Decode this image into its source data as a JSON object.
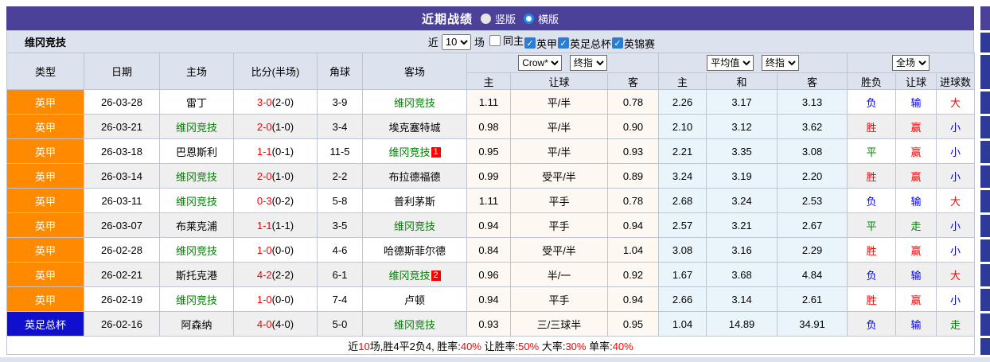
{
  "title_bar": {
    "title": "近期战绩",
    "radio_vertical": "竖版",
    "radio_horizontal": "横版",
    "selected_layout": "横版"
  },
  "filter_bar": {
    "team": "维冈竞技",
    "near_label": "近",
    "near_value": "10",
    "games_label": "场",
    "checkboxes": [
      {
        "label": "同主",
        "checked": false
      },
      {
        "label": "英甲",
        "checked": true
      },
      {
        "label": "英足总杯",
        "checked": true
      },
      {
        "label": "英锦赛",
        "checked": true
      }
    ]
  },
  "icons": {
    "check": "✓"
  },
  "table": {
    "static_headers": [
      "类型",
      "日期",
      "主场",
      "比分(半场)",
      "角球",
      "客场"
    ],
    "group1_selects": [
      "Crow*",
      "终指"
    ],
    "group2_selects": [
      "平均值",
      "终指"
    ],
    "group3_select": "全场",
    "sub_headers_group1": [
      "主",
      "让球",
      "客"
    ],
    "sub_headers_group2": [
      "主",
      "和",
      "客"
    ],
    "sub_headers_group3": [
      "胜负",
      "让球",
      "进球数"
    ],
    "rows": [
      {
        "type": "英甲",
        "type_style": "league",
        "date": "26-03-28",
        "home": {
          "name": "雷丁",
          "self": false
        },
        "score": {
          "full": "3-0",
          "half": "(2-0)"
        },
        "corners": "3-9",
        "away": {
          "name": "维冈竞技",
          "self": true,
          "badge": null
        },
        "asian": [
          "1.11",
          "平/半",
          "0.78"
        ],
        "europe": [
          "2.26",
          "3.17",
          "3.13"
        ],
        "outcome": [
          {
            "t": "负",
            "c": "blue"
          },
          {
            "t": "输",
            "c": "blue"
          },
          {
            "t": "大",
            "c": "red"
          }
        ]
      },
      {
        "type": "英甲",
        "type_style": "league",
        "date": "26-03-21",
        "home": {
          "name": "维冈竞技",
          "self": true
        },
        "score": {
          "full": "2-0",
          "half": "(1-0)"
        },
        "corners": "3-4",
        "away": {
          "name": "埃克塞特城",
          "self": false,
          "badge": null
        },
        "asian": [
          "0.98",
          "平/半",
          "0.90"
        ],
        "europe": [
          "2.10",
          "3.12",
          "3.62"
        ],
        "outcome": [
          {
            "t": "胜",
            "c": "red"
          },
          {
            "t": "赢",
            "c": "red"
          },
          {
            "t": "小",
            "c": "blue"
          }
        ]
      },
      {
        "type": "英甲",
        "type_style": "league",
        "date": "26-03-18",
        "home": {
          "name": "巴恩斯利",
          "self": false
        },
        "score": {
          "full": "1-1",
          "half": "(0-1)"
        },
        "corners": "11-5",
        "away": {
          "name": "维冈竞技",
          "self": true,
          "badge": "1"
        },
        "asian": [
          "0.95",
          "平/半",
          "0.93"
        ],
        "europe": [
          "2.21",
          "3.35",
          "3.08"
        ],
        "outcome": [
          {
            "t": "平",
            "c": "green"
          },
          {
            "t": "赢",
            "c": "red"
          },
          {
            "t": "小",
            "c": "blue"
          }
        ]
      },
      {
        "type": "英甲",
        "type_style": "league",
        "date": "26-03-14",
        "home": {
          "name": "维冈竞技",
          "self": true
        },
        "score": {
          "full": "2-0",
          "half": "(1-0)"
        },
        "corners": "2-2",
        "away": {
          "name": "布拉德福德",
          "self": false,
          "badge": null
        },
        "asian": [
          "0.99",
          "受平/半",
          "0.89"
        ],
        "europe": [
          "3.24",
          "3.19",
          "2.20"
        ],
        "outcome": [
          {
            "t": "胜",
            "c": "red"
          },
          {
            "t": "赢",
            "c": "red"
          },
          {
            "t": "小",
            "c": "blue"
          }
        ]
      },
      {
        "type": "英甲",
        "type_style": "league",
        "date": "26-03-11",
        "home": {
          "name": "维冈竞技",
          "self": true
        },
        "score": {
          "full": "0-3",
          "half": "(0-2)"
        },
        "corners": "5-8",
        "away": {
          "name": "普利茅斯",
          "self": false,
          "badge": null
        },
        "asian": [
          "1.11",
          "平手",
          "0.78"
        ],
        "europe": [
          "2.68",
          "3.24",
          "2.53"
        ],
        "outcome": [
          {
            "t": "负",
            "c": "blue"
          },
          {
            "t": "输",
            "c": "blue"
          },
          {
            "t": "大",
            "c": "red"
          }
        ]
      },
      {
        "type": "英甲",
        "type_style": "league",
        "date": "26-03-07",
        "home": {
          "name": "布莱克浦",
          "self": false
        },
        "score": {
          "full": "1-1",
          "half": "(1-1)"
        },
        "corners": "3-5",
        "away": {
          "name": "维冈竞技",
          "self": true,
          "badge": null
        },
        "asian": [
          "0.94",
          "平手",
          "0.94"
        ],
        "europe": [
          "2.57",
          "3.21",
          "2.67"
        ],
        "outcome": [
          {
            "t": "平",
            "c": "green"
          },
          {
            "t": "走",
            "c": "green"
          },
          {
            "t": "小",
            "c": "blue"
          }
        ]
      },
      {
        "type": "英甲",
        "type_style": "league",
        "date": "26-02-28",
        "home": {
          "name": "维冈竞技",
          "self": true
        },
        "score": {
          "full": "1-0",
          "half": "(0-0)"
        },
        "corners": "4-6",
        "away": {
          "name": "哈德斯菲尔德",
          "self": false,
          "badge": null
        },
        "asian": [
          "0.84",
          "受平/半",
          "1.04"
        ],
        "europe": [
          "3.08",
          "3.16",
          "2.29"
        ],
        "outcome": [
          {
            "t": "胜",
            "c": "red"
          },
          {
            "t": "赢",
            "c": "red"
          },
          {
            "t": "小",
            "c": "blue"
          }
        ]
      },
      {
        "type": "英甲",
        "type_style": "league",
        "date": "26-02-21",
        "home": {
          "name": "斯托克港",
          "self": false
        },
        "score": {
          "full": "4-2",
          "half": "(2-2)"
        },
        "corners": "6-1",
        "away": {
          "name": "维冈竞技",
          "self": true,
          "badge": "2"
        },
        "asian": [
          "0.96",
          "半/一",
          "0.92"
        ],
        "europe": [
          "1.67",
          "3.68",
          "4.84"
        ],
        "outcome": [
          {
            "t": "负",
            "c": "blue"
          },
          {
            "t": "输",
            "c": "blue"
          },
          {
            "t": "大",
            "c": "red"
          }
        ]
      },
      {
        "type": "英甲",
        "type_style": "league",
        "date": "26-02-19",
        "home": {
          "name": "维冈竞技",
          "self": true
        },
        "score": {
          "full": "1-0",
          "half": "(0-0)"
        },
        "corners": "7-4",
        "away": {
          "name": "卢顿",
          "self": false,
          "badge": null
        },
        "asian": [
          "0.94",
          "平手",
          "0.94"
        ],
        "europe": [
          "2.66",
          "3.14",
          "2.61"
        ],
        "outcome": [
          {
            "t": "胜",
            "c": "red"
          },
          {
            "t": "赢",
            "c": "red"
          },
          {
            "t": "小",
            "c": "blue"
          }
        ]
      },
      {
        "type": "英足总杯",
        "type_style": "cup",
        "date": "26-02-16",
        "home": {
          "name": "阿森纳",
          "self": false
        },
        "score": {
          "full": "4-0",
          "half": "(4-0)"
        },
        "corners": "5-0",
        "away": {
          "name": "维冈竞技",
          "self": true,
          "badge": null
        },
        "asian": [
          "0.93",
          "三/三球半",
          "0.95"
        ],
        "europe": [
          "1.04",
          "14.89",
          "34.91"
        ],
        "outcome": [
          {
            "t": "负",
            "c": "blue"
          },
          {
            "t": "输",
            "c": "blue"
          },
          {
            "t": "走",
            "c": "green"
          }
        ]
      }
    ]
  },
  "summary": {
    "segments": [
      {
        "t": "近",
        "r": false
      },
      {
        "t": "10",
        "r": true
      },
      {
        "t": "场,胜4平2负4, 胜率:",
        "r": false
      },
      {
        "t": "40%",
        "r": true
      },
      {
        "t": " 让胜率:",
        "r": false
      },
      {
        "t": "50%",
        "r": true
      },
      {
        "t": " 大率:",
        "r": false
      },
      {
        "t": "30%",
        "r": true
      },
      {
        "t": " 单率:",
        "r": false
      },
      {
        "t": "40%",
        "r": true
      }
    ]
  },
  "colors": {
    "purple": "#4C4198",
    "bar-bg": "#DCE2EE",
    "row-alt": "#EFEFEF",
    "asian-bg": "#FDF8F1",
    "euro-bg": "#E9F4FB",
    "orange": "#FF8A00",
    "cup-blue": "#1010CC",
    "red": "#FF0000",
    "blue": "#0000EE",
    "green": "#008000",
    "strip-blue": "#2E3A97",
    "border": "#BFC6D2",
    "bottom-strip": "#DBE3F1"
  }
}
